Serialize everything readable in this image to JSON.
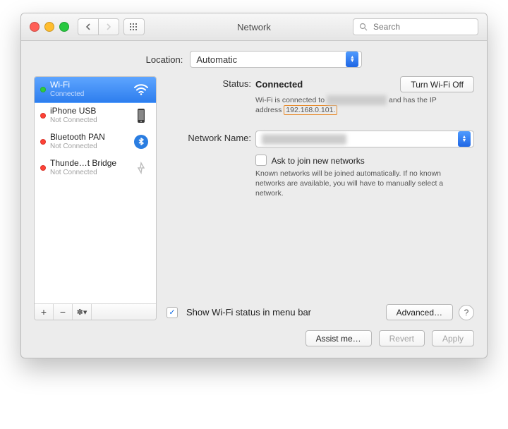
{
  "window": {
    "title": "Network"
  },
  "search": {
    "placeholder": "Search"
  },
  "location": {
    "label": "Location:",
    "value": "Automatic"
  },
  "sidebar": {
    "items": [
      {
        "name": "Wi-Fi",
        "sub": "Connected",
        "icon": "wifi",
        "status": "green",
        "selected": true
      },
      {
        "name": "iPhone USB",
        "sub": "Not Connected",
        "icon": "phone",
        "status": "red",
        "selected": false
      },
      {
        "name": "Bluetooth PAN",
        "sub": "Not Connected",
        "icon": "bluetooth",
        "status": "red",
        "selected": false
      },
      {
        "name": "Thunde…t Bridge",
        "sub": "Not Connected",
        "icon": "tb",
        "status": "red",
        "selected": false
      }
    ]
  },
  "status": {
    "label": "Status:",
    "value": "Connected",
    "turn_off": "Turn Wi-Fi Off",
    "desc_pre": "Wi-Fi is connected to ",
    "ssid_masked": "REDACTED SSID",
    "desc_mid": " and has the IP address ",
    "ip": "192.168.0.101."
  },
  "network_name": {
    "label": "Network Name:",
    "value_masked": "REDACTED"
  },
  "ask_join": {
    "label": "Ask to join new networks",
    "desc": "Known networks will be joined automatically. If no known networks are available, you will have to manually select a network."
  },
  "show_status": {
    "label": "Show Wi-Fi status in menu bar"
  },
  "buttons": {
    "advanced": "Advanced…",
    "assist": "Assist me…",
    "revert": "Revert",
    "apply": "Apply"
  }
}
